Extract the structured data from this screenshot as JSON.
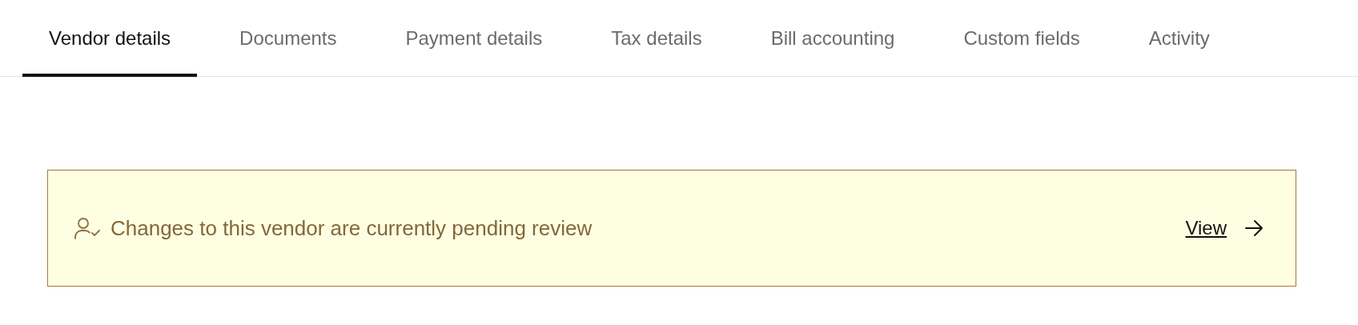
{
  "tabs": [
    {
      "label": "Vendor details",
      "selected": true
    },
    {
      "label": "Documents",
      "selected": false
    },
    {
      "label": "Payment details",
      "selected": false
    },
    {
      "label": "Tax details",
      "selected": false
    },
    {
      "label": "Bill accounting",
      "selected": false
    },
    {
      "label": "Custom fields",
      "selected": false
    },
    {
      "label": "Activity",
      "selected": false
    }
  ],
  "banner": {
    "message": "Changes to this vendor are currently pending review",
    "link": "View"
  }
}
